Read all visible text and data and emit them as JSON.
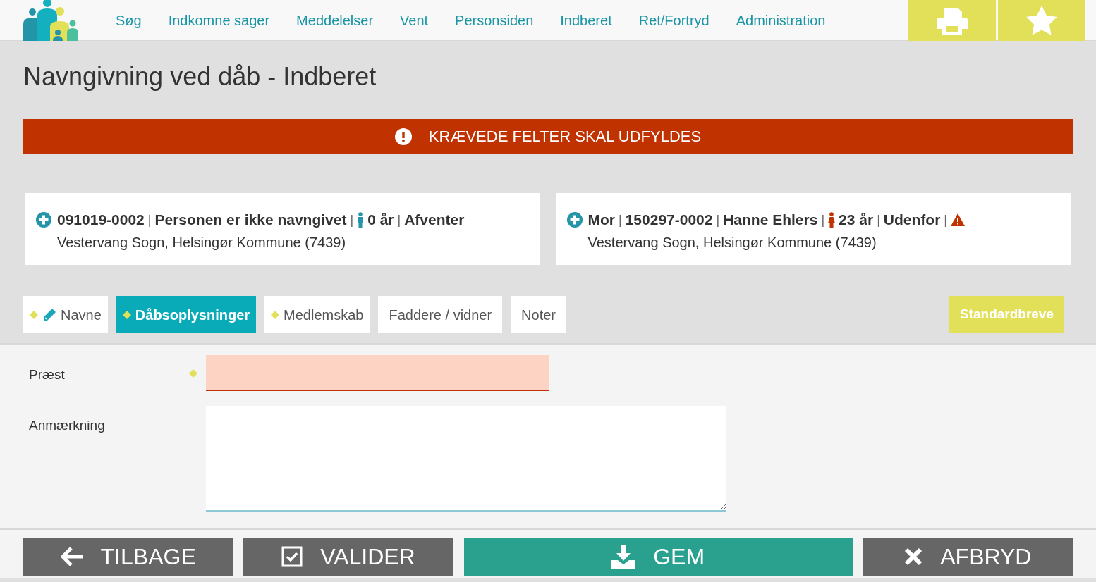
{
  "nav": {
    "items": [
      {
        "label": "Søg"
      },
      {
        "label": "Indkomne sager"
      },
      {
        "label": "Meddelelser"
      },
      {
        "label": "Vent"
      },
      {
        "label": "Personsiden"
      },
      {
        "label": "Indberet"
      },
      {
        "label": "Ret/Fortryd"
      },
      {
        "label": "Administration"
      }
    ]
  },
  "page_title": "Navngivning ved dåb - Indberet",
  "alert": {
    "text": "KRÆVEDE FELTER SKAL UDFYLDES"
  },
  "person_cards": [
    {
      "parts": [
        {
          "kind": "text",
          "text": "091019-0002"
        },
        {
          "kind": "sep",
          "text": "|"
        },
        {
          "kind": "text",
          "text": "Personen er ikke navngivet"
        },
        {
          "kind": "sep",
          "text": "|"
        },
        {
          "kind": "male"
        },
        {
          "kind": "text",
          "text": "0 år"
        },
        {
          "kind": "sep",
          "text": "|"
        },
        {
          "kind": "text",
          "text": "Afventer"
        }
      ],
      "address": "Vestervang Sogn, Helsingør Kommune (7439)"
    },
    {
      "parts": [
        {
          "kind": "text",
          "text": "Mor"
        },
        {
          "kind": "sep",
          "text": "|"
        },
        {
          "kind": "text",
          "text": "150297-0002"
        },
        {
          "kind": "sep",
          "text": "|"
        },
        {
          "kind": "text",
          "text": "Hanne Ehlers"
        },
        {
          "kind": "sep",
          "text": "|"
        },
        {
          "kind": "female"
        },
        {
          "kind": "text",
          "text": "23 år"
        },
        {
          "kind": "sep",
          "text": "|"
        },
        {
          "kind": "text",
          "text": "Udenfor"
        },
        {
          "kind": "sep",
          "text": "|"
        },
        {
          "kind": "warning"
        }
      ],
      "address": "Vestervang Sogn, Helsingør Kommune (7439)"
    }
  ],
  "tabs": [
    {
      "label": "Navne",
      "selected": false,
      "required": true,
      "edited": true
    },
    {
      "label": "Dåbsoplysninger",
      "selected": true,
      "required": true,
      "edited": false
    },
    {
      "label": "Medlemskab",
      "selected": false,
      "required": true,
      "edited": false
    },
    {
      "label": "Faddere / vidner",
      "selected": false,
      "required": false,
      "edited": false
    },
    {
      "label": "Noter",
      "selected": false,
      "required": false,
      "edited": false
    }
  ],
  "letters_button": "Standardbreve",
  "fields": [
    {
      "label": "Præst",
      "kind": "input",
      "required": true,
      "invalid": true
    },
    {
      "label": "Anmærkning",
      "kind": "textarea",
      "required": false,
      "invalid": false
    }
  ],
  "footer_buttons": [
    {
      "label": "TILBAGE",
      "kind": "back"
    },
    {
      "label": "VALIDER",
      "kind": "validate"
    },
    {
      "label": "GEM",
      "kind": "save"
    },
    {
      "label": "AFBRYD",
      "kind": "cancel"
    }
  ]
}
